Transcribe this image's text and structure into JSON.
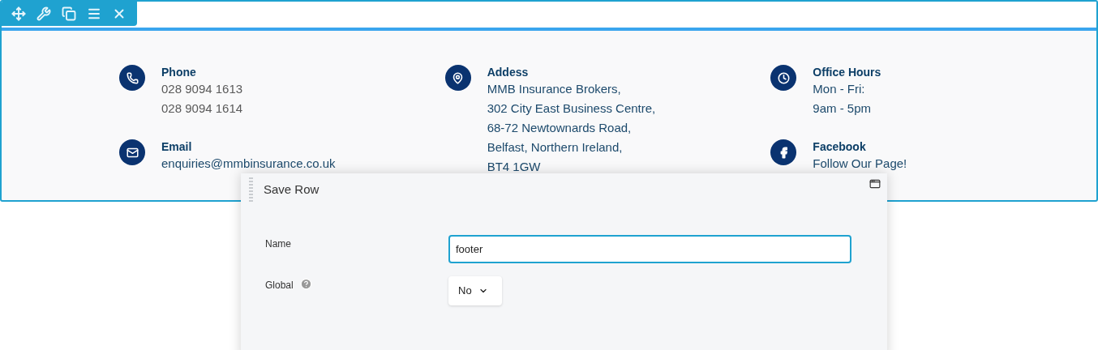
{
  "toolbar": {
    "buttons": [
      {
        "kind": "move"
      },
      {
        "kind": "settings"
      },
      {
        "kind": "duplicate"
      },
      {
        "kind": "menu"
      },
      {
        "kind": "close"
      }
    ]
  },
  "columns": [
    {
      "items": [
        {
          "kind": "phone",
          "title": "Phone",
          "lines": [
            "028 9094 1613",
            "028 9094 1614"
          ]
        },
        {
          "kind": "email",
          "title": "Email",
          "lines": [
            "enquiries@mmbinsurance.co.uk"
          ]
        }
      ]
    },
    {
      "items": [
        {
          "kind": "location",
          "title": "Addess",
          "lines": [
            "MMB Insurance Brokers,",
            "302 City East Business Centre,",
            "68-72 Newtownards Road,",
            "Belfast, Northern Ireland,",
            "BT4 1GW"
          ]
        }
      ]
    },
    {
      "items": [
        {
          "kind": "clock",
          "title": "Office Hours",
          "lines": [
            "Mon - Fri:",
            "9am - 5pm"
          ]
        },
        {
          "kind": "facebook",
          "title": "Facebook",
          "lines": [
            "Follow Our Page!"
          ]
        }
      ]
    }
  ],
  "dialog": {
    "title": "Save Row",
    "fields": [
      {
        "kind": "text",
        "label": "Name",
        "value": "footer",
        "focused": true
      },
      {
        "kind": "select",
        "label": "Global",
        "help": true,
        "value": "No"
      }
    ]
  }
}
